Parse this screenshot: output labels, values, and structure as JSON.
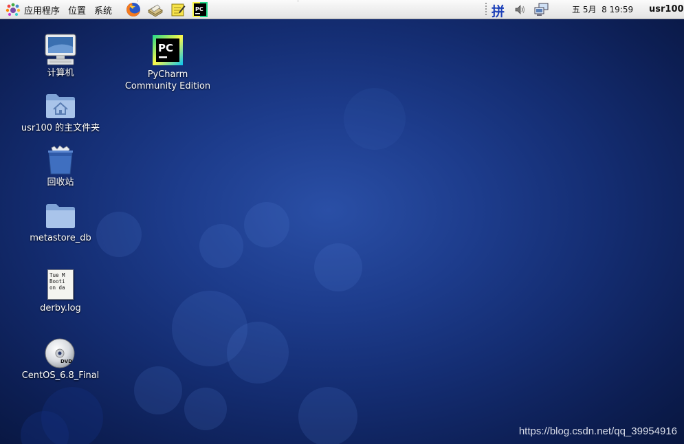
{
  "panel": {
    "menu_apps": "应用程序",
    "menu_places": "位置",
    "menu_system": "系统",
    "launchers": [
      "firefox-icon",
      "mail-icon",
      "notes-icon",
      "pycharm-icon"
    ],
    "input_method": "拼",
    "clock": "五 5月  8 19:59",
    "user": "usr100"
  },
  "desktop": {
    "icons": {
      "computer": "计算机",
      "pycharm_line1": "PyCharm",
      "pycharm_line2": "Community Edition",
      "home": "usr100 的主文件夹",
      "trash": "回收站",
      "metastore": "metastore_db",
      "derby": "derby.log",
      "derby_preview": [
        "Tue M",
        "Booti",
        "on da"
      ],
      "dvd": "CentOS_6.8_Final",
      "dvd_badge": "DVD",
      "pycharm_badge": "PC"
    }
  },
  "watermark": "https://blog.csdn.net/qq_39954916",
  "colors": {
    "desktop_center": "#2a4fa6",
    "desktop_edge": "#08163f",
    "panel_bg": "#efefef"
  }
}
